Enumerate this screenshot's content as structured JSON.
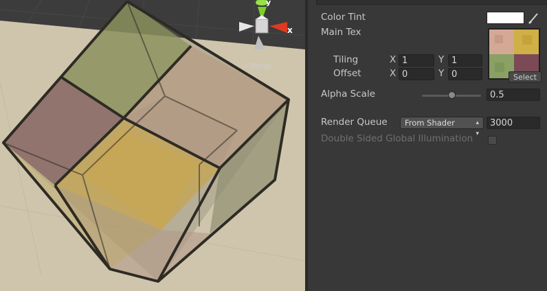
{
  "scene": {
    "gizmo_x": "x",
    "gizmo_y": "y",
    "projection": "Persp"
  },
  "material": {
    "color_tint": {
      "label": "Color Tint",
      "color": "#ffffff"
    },
    "main_tex": {
      "label": "Main Tex",
      "select_label": "Select",
      "tiling": {
        "label": "Tiling",
        "x_label": "X",
        "x": "1",
        "y_label": "Y",
        "y": "1"
      },
      "offset": {
        "label": "Offset",
        "x_label": "X",
        "x": "0",
        "y_label": "Y",
        "y": "0"
      }
    },
    "alpha_scale": {
      "label": "Alpha Scale",
      "value": "0.5",
      "fraction": 0.5
    },
    "render_queue": {
      "label": "Render Queue",
      "mode": "From Shader",
      "value": "3000"
    },
    "double_sided_gi": {
      "label": "Double Sided Global Illumination",
      "checked": false
    }
  },
  "colors": {
    "inspector_bg": "#383838",
    "field_bg": "#2a2a2a",
    "scene_floor": "#cfc5ad",
    "gizmo_x": "#e03a1e",
    "gizmo_y": "#7bd026"
  }
}
